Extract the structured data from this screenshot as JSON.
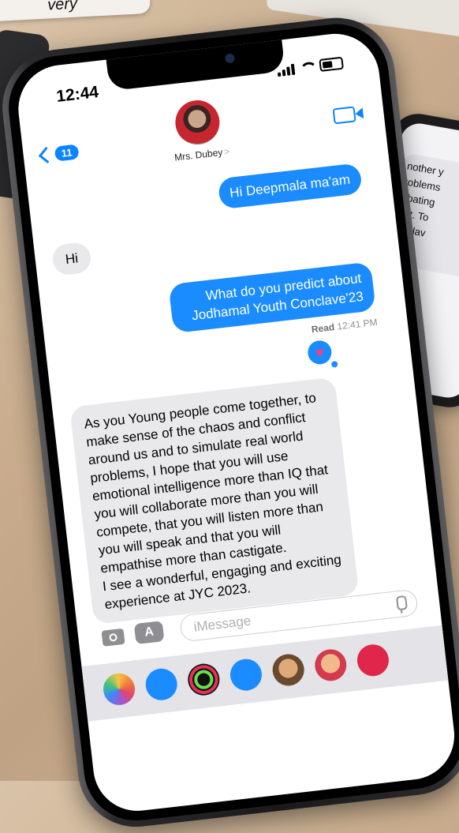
{
  "background": {
    "top_card_text": "very",
    "side_bubble_lines": [
      "nother y",
      "roblems",
      "ebating",
      "est. To",
      "onclav"
    ]
  },
  "status_bar": {
    "time": "12:44"
  },
  "header": {
    "back_badge": "11",
    "contact_name": "Mrs. Dubey",
    "contact_arrow": ">"
  },
  "messages": [
    {
      "direction": "outgoing",
      "text": "Hi Deepmala ma'am"
    },
    {
      "direction": "incoming",
      "text": "Hi"
    },
    {
      "direction": "outgoing",
      "text": "What do you predict about Jodhamal Youth Conclave'23"
    },
    {
      "direction": "incoming",
      "text": "As you Young people come together, to make sense of the chaos and conflict around us and to simulate real world problems, I hope that you will use emotional intelligence more than IQ that you will collaborate more than you will compete, that you will listen more than you will speak and that you will empathise more than castigate.\nI see a wonderful, engaging and exciting experience at JYC 2023."
    }
  ],
  "read_receipt": {
    "label": "Read",
    "time": "12:41 PM"
  },
  "tapback": {
    "icon": "heart-icon"
  },
  "composer": {
    "placeholder": "iMessage",
    "app_button_glyph": "A"
  },
  "app_tray": [
    {
      "icon": "photos-icon",
      "color": "#ffffff"
    },
    {
      "icon": "app-store-icon",
      "color": "#1a8cff"
    },
    {
      "icon": "activity-rings-icon",
      "color": "#111111"
    },
    {
      "icon": "audio-message-icon",
      "color": "#1a8cff"
    },
    {
      "icon": "memoji-icon",
      "color": "#7a5a3a"
    },
    {
      "icon": "memoji-stickers-icon",
      "color": "#e8b07a"
    },
    {
      "icon": "search-images-icon",
      "color": "#e0264a"
    }
  ]
}
